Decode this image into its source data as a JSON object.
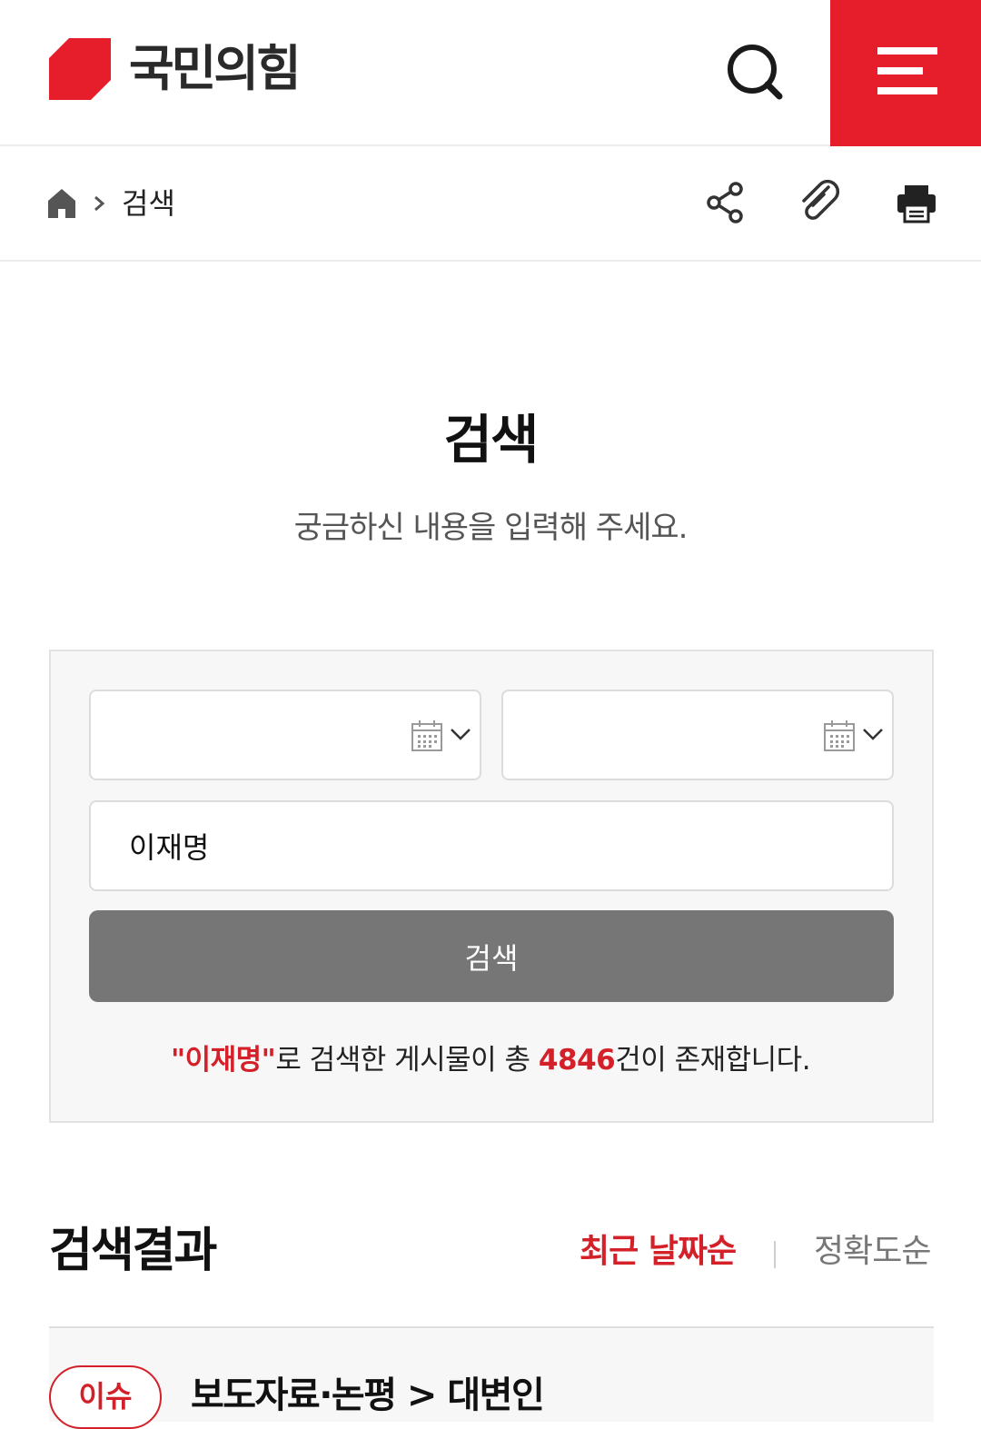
{
  "header": {
    "logo_text": "국민의힘",
    "brand_color": "#e61e2b",
    "icons": {
      "search": "search-icon",
      "menu": "hamburger-menu-icon"
    }
  },
  "breadcrumb": {
    "home_icon": "home-icon",
    "separator_icon": "chevron-right-icon",
    "current": "검색",
    "tools": [
      "share-icon",
      "attachment-icon",
      "print-icon"
    ]
  },
  "page": {
    "title": "검색",
    "subtitle": "궁금하신 내용을 입력해 주세요."
  },
  "search": {
    "start_date": "",
    "end_date": "",
    "keyword": "이재명",
    "submit_label": "검색",
    "result_prefix": "\"이재명\"",
    "result_mid": "로 검색한 게시물이 총 ",
    "result_count": "4846",
    "result_suffix": "건이 존재합니다."
  },
  "results": {
    "heading": "검색결과",
    "sort_recent": "최근 날짜순",
    "sort_accuracy": "정확도순",
    "accent_color": "#d42029",
    "items": [
      {
        "badge": "이슈",
        "path": "보도자료·논평 > 대변인"
      }
    ]
  }
}
